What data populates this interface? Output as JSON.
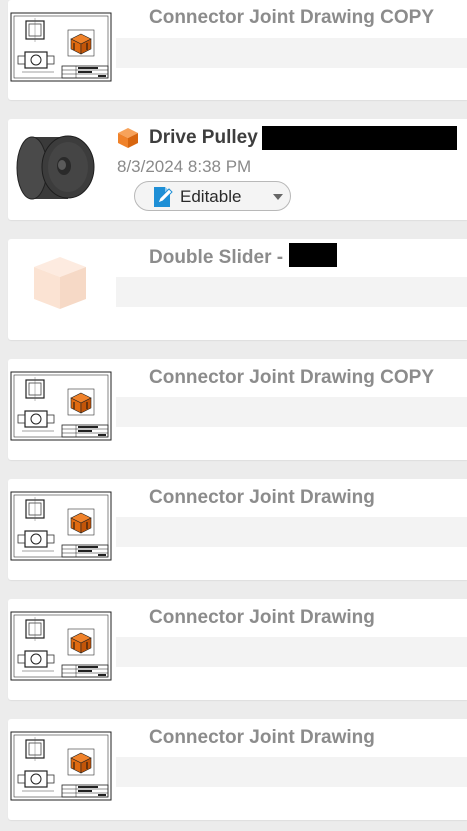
{
  "items": [
    {
      "title": "Connector Joint Drawing COPY",
      "type": "drawing-thumbnail"
    },
    {
      "title": "Drive Pulley",
      "date": "8/3/2024 8:38 PM",
      "status_label": "Editable",
      "type": "pulley-thumbnail",
      "icon": "orange-cube-icon"
    },
    {
      "title": "Double Slider -",
      "type": "faint-cube-thumbnail"
    },
    {
      "title": "Connector Joint Drawing COPY",
      "type": "drawing-thumbnail"
    },
    {
      "title": "Connector Joint Drawing",
      "type": "drawing-thumbnail"
    },
    {
      "title": "Connector Joint Drawing",
      "type": "drawing-thumbnail"
    },
    {
      "title": "Connector Joint Drawing",
      "type": "drawing-thumbnail"
    }
  ],
  "colors": {
    "accent_orange": "#f0822a",
    "editable_blue": "#1e8fd6"
  }
}
